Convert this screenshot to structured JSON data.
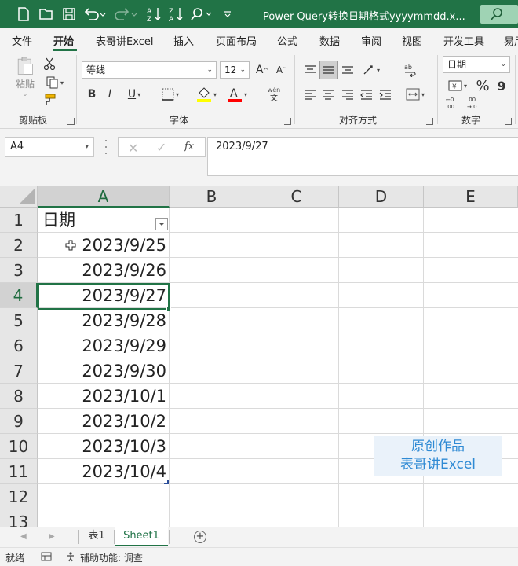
{
  "window": {
    "title": "Power Query转换日期格式yyyymmdd.x..."
  },
  "ribbon_tabs": [
    {
      "label": "文件"
    },
    {
      "label": "开始"
    },
    {
      "label": "表哥讲Excel"
    },
    {
      "label": "插入"
    },
    {
      "label": "页面布局"
    },
    {
      "label": "公式"
    },
    {
      "label": "数据"
    },
    {
      "label": "审阅"
    },
    {
      "label": "视图"
    },
    {
      "label": "开发工具"
    },
    {
      "label": "易用"
    }
  ],
  "ribbon": {
    "clipboard": {
      "paste_label": "粘贴",
      "group_label": "剪贴板"
    },
    "font": {
      "font_name": "等线",
      "font_size": "12",
      "group_label": "字体",
      "phonetic_top": "wén",
      "phonetic_bottom": "文"
    },
    "alignment": {
      "group_label": "对齐方式"
    },
    "number": {
      "format": "日期",
      "group_label": "数字"
    },
    "colors": {
      "highlight": "#ffff00",
      "font": "#ff0000"
    }
  },
  "formula_bar": {
    "name_box": "A4",
    "fx_label": "fx",
    "content": "2023/9/27"
  },
  "sheet": {
    "columns": [
      "A",
      "B",
      "C",
      "D",
      "E"
    ],
    "rows": [
      "1",
      "2",
      "3",
      "4",
      "5",
      "6",
      "7",
      "8",
      "9",
      "10",
      "11",
      "12",
      "13"
    ],
    "header_cell": "日期",
    "dates": [
      "2023/9/25",
      "2023/9/26",
      "2023/9/27",
      "2023/9/28",
      "2023/9/29",
      "2023/9/30",
      "2023/10/1",
      "2023/10/2",
      "2023/10/3",
      "2023/10/4"
    ]
  },
  "watermark": {
    "line1": "原创作品",
    "line2": "表哥讲Excel"
  },
  "sheet_tabs": [
    {
      "label": "表1"
    },
    {
      "label": "Sheet1"
    }
  ],
  "status": {
    "mode": "就绪",
    "accessibility": "辅助功能: 调查"
  },
  "accent_color": "#217346"
}
